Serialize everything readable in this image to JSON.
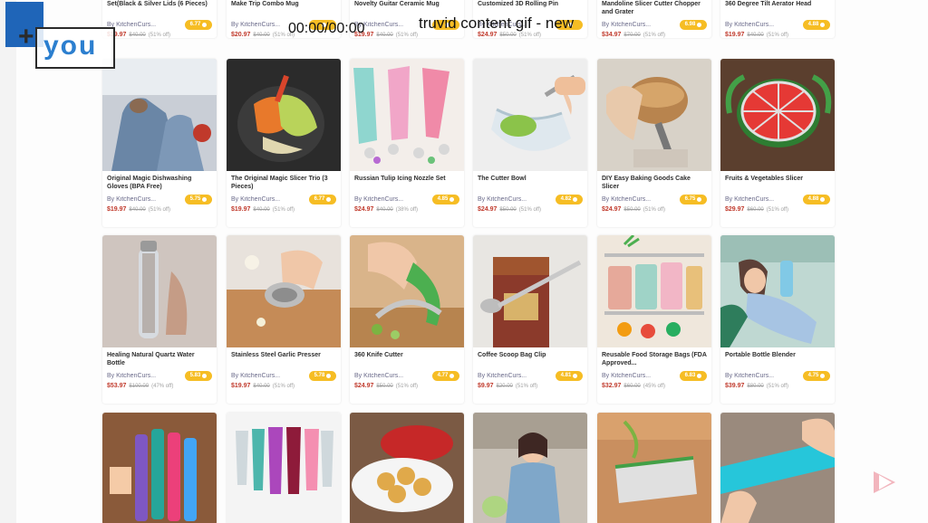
{
  "overlay": {
    "logo_text": "you",
    "logo_plus": "+",
    "timer": "00:00/00:00",
    "title": "truvid content gif - new"
  },
  "colors": {
    "button": "#f6bd24",
    "price": "#c0392b",
    "logo_blue": "#1f65b8"
  },
  "products_row0": [
    {
      "title": "Set(Black & Silver Lids (6 Pieces)",
      "by": "By KitchenCurs...",
      "btn": "6.77",
      "price": "$19.97",
      "old": "$40.00",
      "off": "(51% off)"
    },
    {
      "title": "Make Trip Combo Mug",
      "by": "By KitchenCurs...",
      "btn": "",
      "price": "$20.97",
      "old": "$40.00",
      "off": "(51% off)"
    },
    {
      "title": "Novelty Guitar Ceramic Mug",
      "by": "By KitchenCurs...",
      "btn": "",
      "price": "$19.97",
      "old": "$40.00",
      "off": "(51% off)"
    },
    {
      "title": "Customized 3D Rolling Pin",
      "by": "By KitchenCurs...",
      "btn": "",
      "price": "$24.97",
      "old": "$50.00",
      "off": "(51% off)"
    },
    {
      "title": "Mandoline Slicer Cutter Chopper and Grater",
      "by": "By KitchenCurs...",
      "btn": "6.98",
      "price": "$34.97",
      "old": "$70.00",
      "off": "(51% off)"
    },
    {
      "title": "360 Degree Tilt Aerator Head",
      "by": "By KitchenCurs...",
      "btn": "4.88",
      "price": "$19.97",
      "old": "$40.00",
      "off": "(51% off)"
    }
  ],
  "products_row1": [
    {
      "title": "Original Magic Dishwashing Gloves (BPA Free)",
      "by": "By KitchenCurs...",
      "btn": "5.75",
      "price": "$19.97",
      "old": "$40.00",
      "off": "(51% off)"
    },
    {
      "title": "The Original Magic Slicer Trio (3 Pieces)",
      "by": "By KitchenCurs...",
      "btn": "6.77",
      "price": "$19.97",
      "old": "$40.00",
      "off": "(51% off)"
    },
    {
      "title": "Russian Tulip Icing Nozzle Set",
      "by": "By KitchenCurs...",
      "btn": "4.85",
      "price": "$24.97",
      "old": "$40.00",
      "off": "(38% off)"
    },
    {
      "title": "The Cutter Bowl",
      "by": "By KitchenCurs...",
      "btn": "4.82",
      "price": "$24.97",
      "old": "$50.00",
      "off": "(51% off)"
    },
    {
      "title": "DIY Easy Baking Goods Cake Slicer",
      "by": "By KitchenCurs...",
      "btn": "6.75",
      "price": "$24.97",
      "old": "$50.00",
      "off": "(51% off)"
    },
    {
      "title": "Fruits & Vegetables Slicer",
      "by": "By KitchenCurs...",
      "btn": "4.88",
      "price": "$29.97",
      "old": "$60.00",
      "off": "(51% off)"
    }
  ],
  "products_row2": [
    {
      "title": "Healing Natural Quartz Water Bottle",
      "by": "By KitchenCurs...",
      "btn": "5.83",
      "price": "$53.97",
      "old": "$100.00",
      "off": "(47% off)"
    },
    {
      "title": "Stainless Steel Garlic Presser",
      "by": "By KitchenCurs...",
      "btn": "5.78",
      "price": "$19.97",
      "old": "$40.00",
      "off": "(51% off)"
    },
    {
      "title": "360 Knife Cutter",
      "by": "By KitchenCurs...",
      "btn": "4.77",
      "price": "$24.97",
      "old": "$50.00",
      "off": "(51% off)"
    },
    {
      "title": "Coffee Scoop Bag Clip",
      "by": "By KitchenCurs...",
      "btn": "4.81",
      "price": "$9.97",
      "old": "$20.00",
      "off": "(51% off)"
    },
    {
      "title": "Reusable Food Storage Bags (FDA Approved...",
      "by": "By KitchenCurs...",
      "btn": "6.83",
      "price": "$32.97",
      "old": "$60.00",
      "off": "(45% off)"
    },
    {
      "title": "Portable Bottle Blender",
      "by": "By KitchenCurs...",
      "btn": "4.75",
      "price": "$39.97",
      "old": "$80.00",
      "off": "(51% off)"
    }
  ]
}
